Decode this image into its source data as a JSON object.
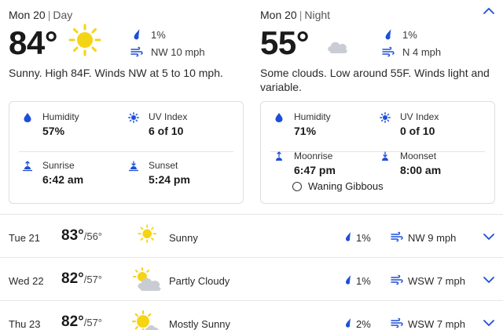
{
  "colors": {
    "accent": "#1d4fd8",
    "sun": "#f5d414",
    "cloud": "#c9ccd3",
    "divider": "#e4e4e4"
  },
  "day": {
    "date": "Mon 20",
    "part": "Day",
    "temp": "84°",
    "icon": "sun-icon",
    "precip": "1%",
    "wind": "NW 10 mph",
    "summary": "Sunny. High 84F. Winds NW at 5 to 10 mph.",
    "humidity_label": "Humidity",
    "humidity": "57%",
    "uv_label": "UV Index",
    "uv": "6 of 10",
    "sunrise_label": "Sunrise",
    "sunrise": "6:42 am",
    "sunset_label": "Sunset",
    "sunset": "5:24 pm"
  },
  "night": {
    "date": "Mon 20",
    "part": "Night",
    "temp": "55°",
    "icon": "moon-cloud-icon",
    "precip": "1%",
    "wind": "N 4 mph",
    "summary": "Some clouds. Low around 55F. Winds light and variable.",
    "humidity_label": "Humidity",
    "humidity": "71%",
    "uv_label": "UV Index",
    "uv": "0 of 10",
    "moonrise_label": "Moonrise",
    "moonrise": "6:47 pm",
    "moonset_label": "Moonset",
    "moonset": "8:00 am",
    "moon_phase": "Waning Gibbous"
  },
  "forecast": [
    {
      "day": "Tue 21",
      "high": "83°",
      "low": "/56°",
      "icon": "sun-icon",
      "condition": "Sunny",
      "precip": "1%",
      "wind": "NW 9 mph"
    },
    {
      "day": "Wed 22",
      "high": "82°",
      "low": "/57°",
      "icon": "partly-cloudy-icon",
      "condition": "Partly Cloudy",
      "precip": "1%",
      "wind": "WSW 7 mph"
    },
    {
      "day": "Thu 23",
      "high": "82°",
      "low": "/57°",
      "icon": "mostly-sunny-icon",
      "condition": "Mostly Sunny",
      "precip": "2%",
      "wind": "WSW 7 mph"
    }
  ]
}
